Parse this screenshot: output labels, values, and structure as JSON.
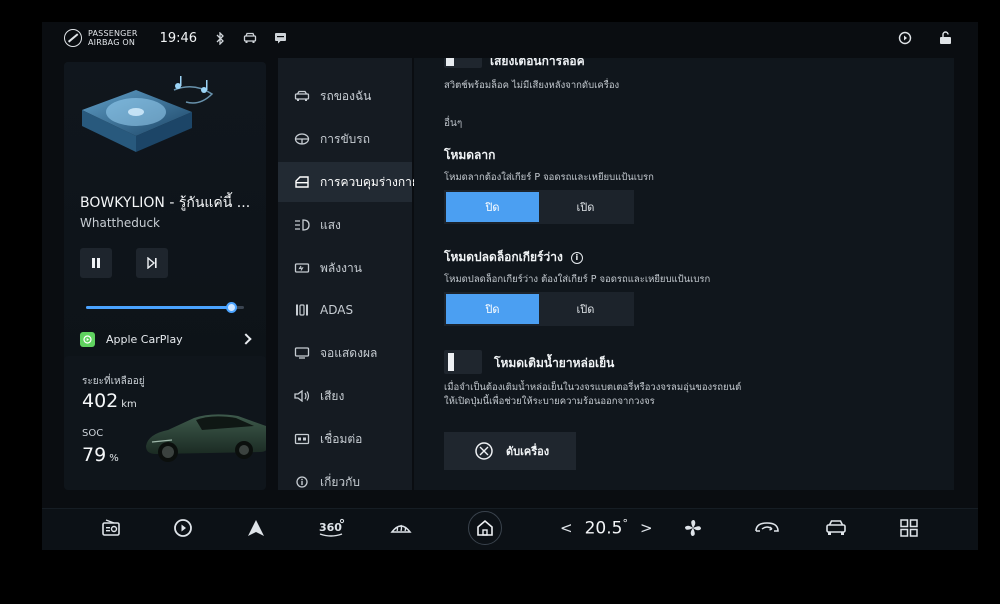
{
  "status": {
    "airbag_line1": "PASSENGER",
    "airbag_line2": "AIRBAG  ON",
    "time": "19:46",
    "icons_left": [
      "airbag-off-icon",
      "bluetooth-icon",
      "car-icon",
      "message-icon"
    ],
    "icons_right": [
      "carplay-icon",
      "unlock-icon"
    ]
  },
  "media": {
    "title": "BOWKYLION - รู้กันแค่นี้ ...",
    "artist": "Whattheduck",
    "progress": 0.92,
    "source_label": "Apple CarPlay"
  },
  "vehicle": {
    "range_label": "ระยะที่เหลืออยู่",
    "range_value": "402",
    "range_unit": "km",
    "soc_label": "SOC",
    "soc_value": "79",
    "soc_unit": "%"
  },
  "nav": {
    "items": [
      {
        "label": "รถของฉัน",
        "icon": "car-icon"
      },
      {
        "label": "การขับรถ",
        "icon": "steering-icon"
      },
      {
        "label": "การควบคุมร่างกาย",
        "icon": "door-icon",
        "active": true
      },
      {
        "label": "แสง",
        "icon": "light-icon"
      },
      {
        "label": "พลังงาน",
        "icon": "battery-icon"
      },
      {
        "label": "ADAS",
        "icon": "adas-icon"
      },
      {
        "label": "จอแสดงผล",
        "icon": "display-icon"
      },
      {
        "label": "เสียง",
        "icon": "speaker-icon"
      },
      {
        "label": "เชื่อมต่อ",
        "icon": "connect-icon"
      },
      {
        "label": "เกี่ยวกับ",
        "icon": "info-icon"
      }
    ]
  },
  "content": {
    "top_title": "เสียงเตือนการล็อค",
    "top_desc": "สวิตช์พร้อมล็อค ไม่มีเสียงหลังจากดับเครื่อง",
    "section_other": "อื่นๆ",
    "tow_mode": {
      "title": "โหมดลาก",
      "desc": "โหมดลากต้องใส่เกียร์ P จอดรถและเหยียบแป้นเบรก",
      "opt_off": "ปิด",
      "opt_on": "เปิด",
      "selected": "ปิด"
    },
    "neutral_mode": {
      "title": "โหมดปลดล็อกเกียร์ว่าง",
      "desc": "โหมดปลดล็อกเกียร์ว่าง ต้องใส่เกียร์ P จอดรถและเหยียบแป้นเบรก",
      "opt_off": "ปิด",
      "opt_on": "เปิด",
      "selected": "ปิด"
    },
    "coolant_mode": {
      "title": "โหมดเติมน้ำยาหล่อเย็น",
      "desc_line1": "เมื่อจำเป็นต้องเติมน้ำหล่อเย็นในวงจรแบตเตอรี่หรือวงจรลมอุ่นของรถยนต์",
      "desc_line2": "ให้เปิดปุ่มนี้เพื่อช่วยให้ระบายความร้อนออกจากวงจร"
    },
    "power_off_label": "ดับเครื่อง"
  },
  "dock": {
    "temperature": "20.5",
    "temp_unit": "°",
    "icons": [
      "radio-icon",
      "carplay-icon",
      "navigation-icon",
      "camera-360-icon",
      "defrost-icon",
      "home-icon",
      "fan-icon",
      "air-recirculation-icon",
      "car-icon",
      "apps-grid-icon"
    ]
  }
}
